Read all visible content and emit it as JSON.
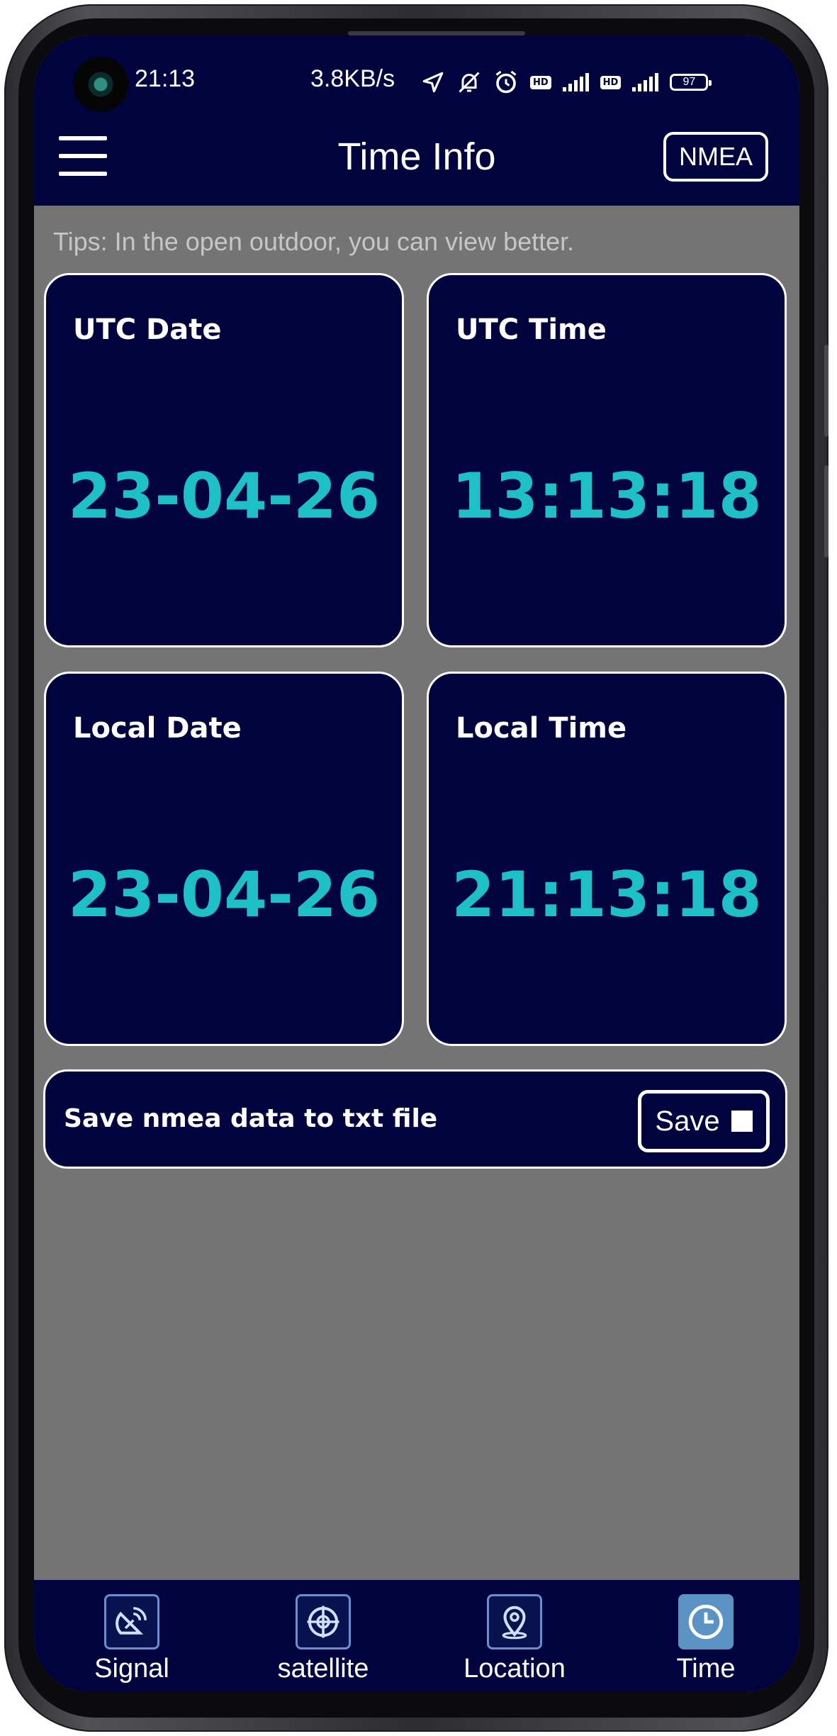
{
  "status_bar": {
    "time": "21:13",
    "network_speed": "3.8KB/s",
    "battery": "97",
    "icons": [
      "location-arrow-icon",
      "mute-icon",
      "alarm-icon",
      "hd-icon",
      "signal-4g-icon",
      "hd-icon",
      "signal-4g-icon",
      "battery-icon"
    ]
  },
  "header": {
    "title": "Time Info",
    "nmea_label": "NMEA",
    "menu_icon": "hamburger-menu-icon"
  },
  "tips": "Tips: In the open outdoor, you can view better.",
  "cards": {
    "utc_date": {
      "label": "UTC Date",
      "value": "23-04-26"
    },
    "utc_time": {
      "label": "UTC Time",
      "value": "13:13:18"
    },
    "local_date": {
      "label": "Local Date",
      "value": "23-04-26"
    },
    "local_time": {
      "label": "Local Time",
      "value": "21:13:18"
    }
  },
  "save": {
    "description": "Save nmea data to txt file",
    "button_label": "Save",
    "checked": false
  },
  "bottom_nav": [
    {
      "label": "Signal",
      "icon": "satellite-dish-icon",
      "active": false
    },
    {
      "label": "satellite",
      "icon": "globe-target-icon",
      "active": false
    },
    {
      "label": "Location",
      "icon": "map-pin-icon",
      "active": false
    },
    {
      "label": "Time",
      "icon": "clock-icon",
      "active": true
    }
  ],
  "colors": {
    "primary_dark": "#00033d",
    "accent_cyan": "#1dc0c7",
    "background_gray": "#747474",
    "nav_active": "#5b93c5"
  }
}
